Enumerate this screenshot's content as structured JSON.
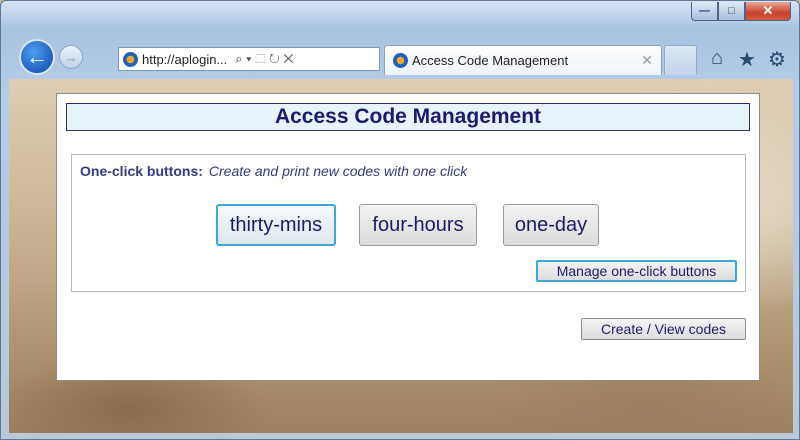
{
  "browser": {
    "address_url": "http://aplogin...",
    "address_tools": "⌕ ▾ ⬚ ↻ ✕",
    "tab_title": "Access Code Management",
    "tab_close": "✕",
    "caption": {
      "minimize": "—",
      "maximize": "□",
      "close": "✕"
    }
  },
  "page": {
    "title": "Access Code Management",
    "one_click": {
      "label": "One-click buttons:",
      "description": "Create and print new codes with one click",
      "buttons": [
        "thirty-mins",
        "four-hours",
        "one-day"
      ],
      "manage_label": "Manage one-click buttons"
    },
    "create_view_label": "Create / View codes"
  },
  "colors": {
    "heading": "#1b1b6b",
    "title_bg": "#e6f3fb",
    "focus_border": "#3fa6d8"
  }
}
